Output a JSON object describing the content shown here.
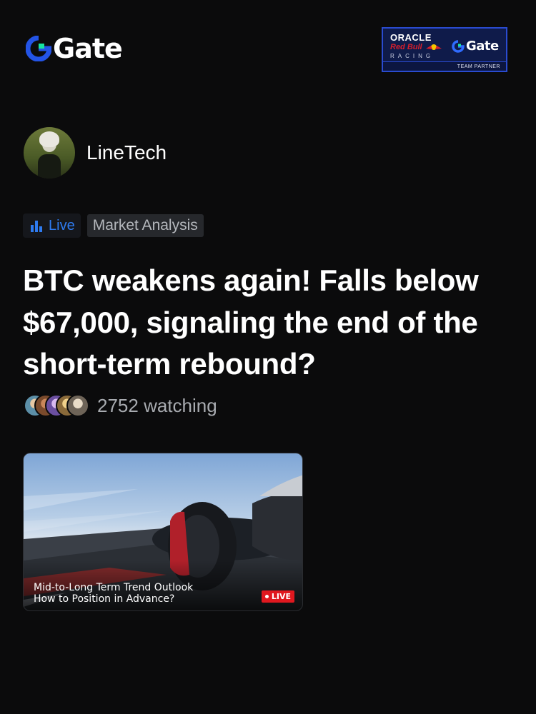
{
  "header": {
    "brand": "Gate",
    "partner": {
      "line1": "ORACLE",
      "line2": "Red Bull",
      "line3": "RACING",
      "brand": "Gate",
      "footer": "TEAM PARTNER"
    }
  },
  "author": {
    "name": "LineTech"
  },
  "tags": {
    "live_label": "Live",
    "category": "Market Analysis"
  },
  "post": {
    "title": "BTC weakens again! Falls below $67,000, signaling the end of the short-term rebound?"
  },
  "audience": {
    "watching": "2752 watching"
  },
  "video": {
    "caption_line1": "Mid-to-Long Term Trend Outlook",
    "caption_line2": "How to Position in Advance?",
    "live_badge": "LIVE"
  },
  "colors": {
    "background": "#0b0b0c",
    "accent_blue": "#2e7bf0",
    "live_red": "#e0181f"
  }
}
